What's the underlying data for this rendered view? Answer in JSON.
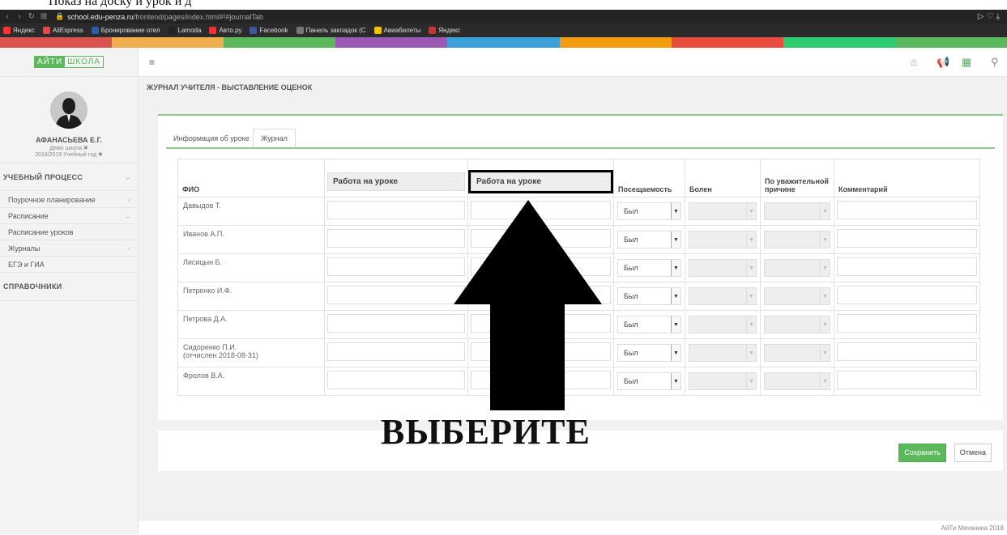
{
  "caption": "Показ на доску и урок и д",
  "browser": {
    "url_host": "school.edu-penza.ru",
    "url_path": "/frontend/pages/index.html#!#journalTab",
    "bookmarks": [
      {
        "label": "Яндекс",
        "color": "#f33"
      },
      {
        "label": "AliExpress",
        "color": "#e44"
      },
      {
        "label": "Бронирование отел",
        "color": "#2a5db0"
      },
      {
        "label": "Lamoda",
        "color": "#222"
      },
      {
        "label": "Авто.ру",
        "color": "#e33"
      },
      {
        "label": "Facebook",
        "color": "#3b5998"
      },
      {
        "label": "Панель закладок (С",
        "color": "#777"
      },
      {
        "label": "Авиабилеты",
        "color": "#f5c400"
      },
      {
        "label": "Яндекс",
        "color": "#c33"
      }
    ],
    "stripe_colors": [
      "#d9534f",
      "#f0ad4e",
      "#5cb85c",
      "#9b59b6",
      "#3da0d8",
      "#f39c12",
      "#e74c3c",
      "#2ecc71",
      "#5cb85c"
    ]
  },
  "sidebar": {
    "logo_left": "АЙТИ",
    "logo_right": "ШКОЛА",
    "user_name": "АФАНАСЬЕВА Е.Г.",
    "school": "Демо школа ✖",
    "year": "2018/2019 Учебный год ✖",
    "menu": [
      {
        "label": "УЧЕБНЫЙ ПРОЦЕСС",
        "chevron": "⌄",
        "section": true
      },
      {
        "label": "Поурочное планирование",
        "chevron": "‹"
      },
      {
        "label": "Расписание",
        "chevron": "⌄"
      },
      {
        "label": "Расписание уроков",
        "chevron": ""
      },
      {
        "label": "Журналы",
        "chevron": "‹"
      },
      {
        "label": "ЕГЭ и ГИА",
        "chevron": ""
      },
      {
        "label": "СПРАВОЧНИКИ",
        "chevron": "",
        "section": true
      }
    ]
  },
  "main": {
    "title": "ЖУРНАЛ УЧИТЕЛЯ - ВЫСТАВЛЕНИЕ ОЦЕНОК",
    "tabs": [
      "Информация об уроке",
      "Журнал"
    ],
    "columns": {
      "fio": "ФИО",
      "work1": "Работа на уроке",
      "work2": "Работа на уроке",
      "dots": "···",
      "attendance": "Посещаемость",
      "sick": "Болен",
      "valid_reason": "По уважительной причине",
      "comment": "Комментарий"
    },
    "students": [
      {
        "name": "Давыдов Т.",
        "note": "",
        "attendance": "Был"
      },
      {
        "name": "Иванов А.П.",
        "note": "",
        "attendance": "Был"
      },
      {
        "name": "Лисицын Б.",
        "note": "",
        "attendance": "Был"
      },
      {
        "name": "Петренко И.Ф.",
        "note": "",
        "attendance": "Был"
      },
      {
        "name": "Петрова Д.А.",
        "note": "",
        "attendance": "Был"
      },
      {
        "name": "Сидоренко П.И.",
        "note": "(отчислен 2018-08-31)",
        "attendance": "Был",
        "expelled": true
      },
      {
        "name": "Фролов В.А.",
        "note": "",
        "attendance": "Был"
      }
    ],
    "arrow_caption": "ВЫБЕРИТЕ",
    "save": "Сохранить",
    "cancel": "Отмена",
    "footer": "АйТи Механика 2018"
  }
}
